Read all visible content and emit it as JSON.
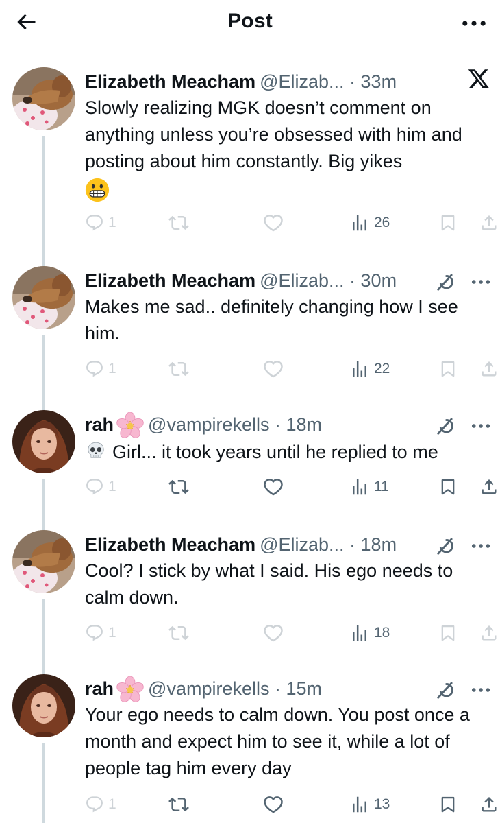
{
  "header": {
    "title": "Post"
  },
  "posts": [
    {
      "name": "Elizabeth Meacham",
      "handle": "@Elizab...",
      "time": "33m",
      "text": "Slowly realizing MGK doesn’t comment on anything unless you’re obsessed with him and posting about him constantly. Big yikes",
      "emoji": "grimacing-face",
      "replies": "1",
      "views": "26"
    },
    {
      "name": "Elizabeth Meacham",
      "handle": "@Elizab...",
      "time": "30m",
      "text": "Makes me sad.. definitely changing how I see him.",
      "replies": "1",
      "views": "22"
    },
    {
      "name": "rah",
      "handle": "@vampirekells",
      "time": "18m",
      "text": "Girl... it took years until he replied to me",
      "emoji": "skull",
      "replies": "1",
      "views": "11"
    },
    {
      "name": "Elizabeth Meacham",
      "handle": "@Elizab...",
      "time": "18m",
      "text": "Cool? I stick by what I said. His ego needs to calm down.",
      "replies": "1",
      "views": "18"
    },
    {
      "name": "rah",
      "handle": "@vampirekells",
      "time": "15m",
      "text": "Your ego needs to calm down. You post once a month and expect him to see it, while a lot of people tag him every day",
      "replies": "1",
      "views": "13"
    }
  ]
}
